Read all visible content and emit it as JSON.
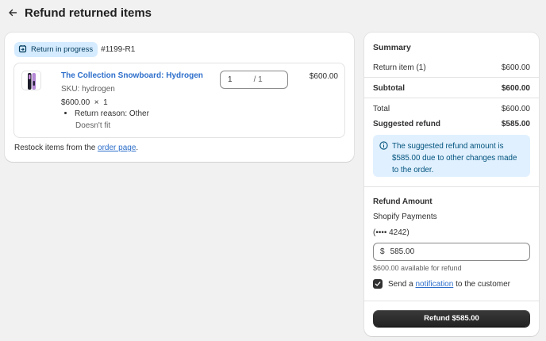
{
  "header": {
    "title": "Refund returned items"
  },
  "return": {
    "status_label": "Return in progress",
    "order_number": "#1199-R1",
    "item": {
      "title": "The Collection Snowboard: Hydrogen",
      "sku": "SKU: hydrogen",
      "price_qty": "$600.00  ×  1",
      "reason": "Return reason: Other",
      "reason_detail": "Doesn't fit",
      "quantity_value": "1",
      "quantity_suffix": "/ 1",
      "total": "$600.00"
    },
    "restock_prefix": "Restock items from the ",
    "restock_link": "order page",
    "restock_suffix": "."
  },
  "summary": {
    "title": "Summary",
    "rows": [
      {
        "label": "Return item (1)",
        "value": "$600.00"
      },
      {
        "label": "Subtotal",
        "value": "$600.00"
      },
      {
        "label": "Total",
        "value": "$600.00"
      },
      {
        "label": "Suggested refund",
        "value": "$585.00"
      }
    ],
    "banner_text": "The suggested refund amount is $585.00 due to other changes made to the order."
  },
  "refund_amount": {
    "title": "Refund Amount",
    "method": "Shopify Payments",
    "card": "(•••• 4242)",
    "currency_symbol": "$",
    "amount_value": "585.00",
    "available_text": "$600.00 available for refund",
    "notify_prefix": "Send a ",
    "notify_link": "notification",
    "notify_suffix": " to the customer",
    "notify_checked": true,
    "button_label": "Refund $585.00"
  },
  "colors": {
    "link": "#2c6ecb",
    "badge_bg": "#d5ebff",
    "banner_bg": "#e0f0ff",
    "primary_button": "#303030"
  }
}
